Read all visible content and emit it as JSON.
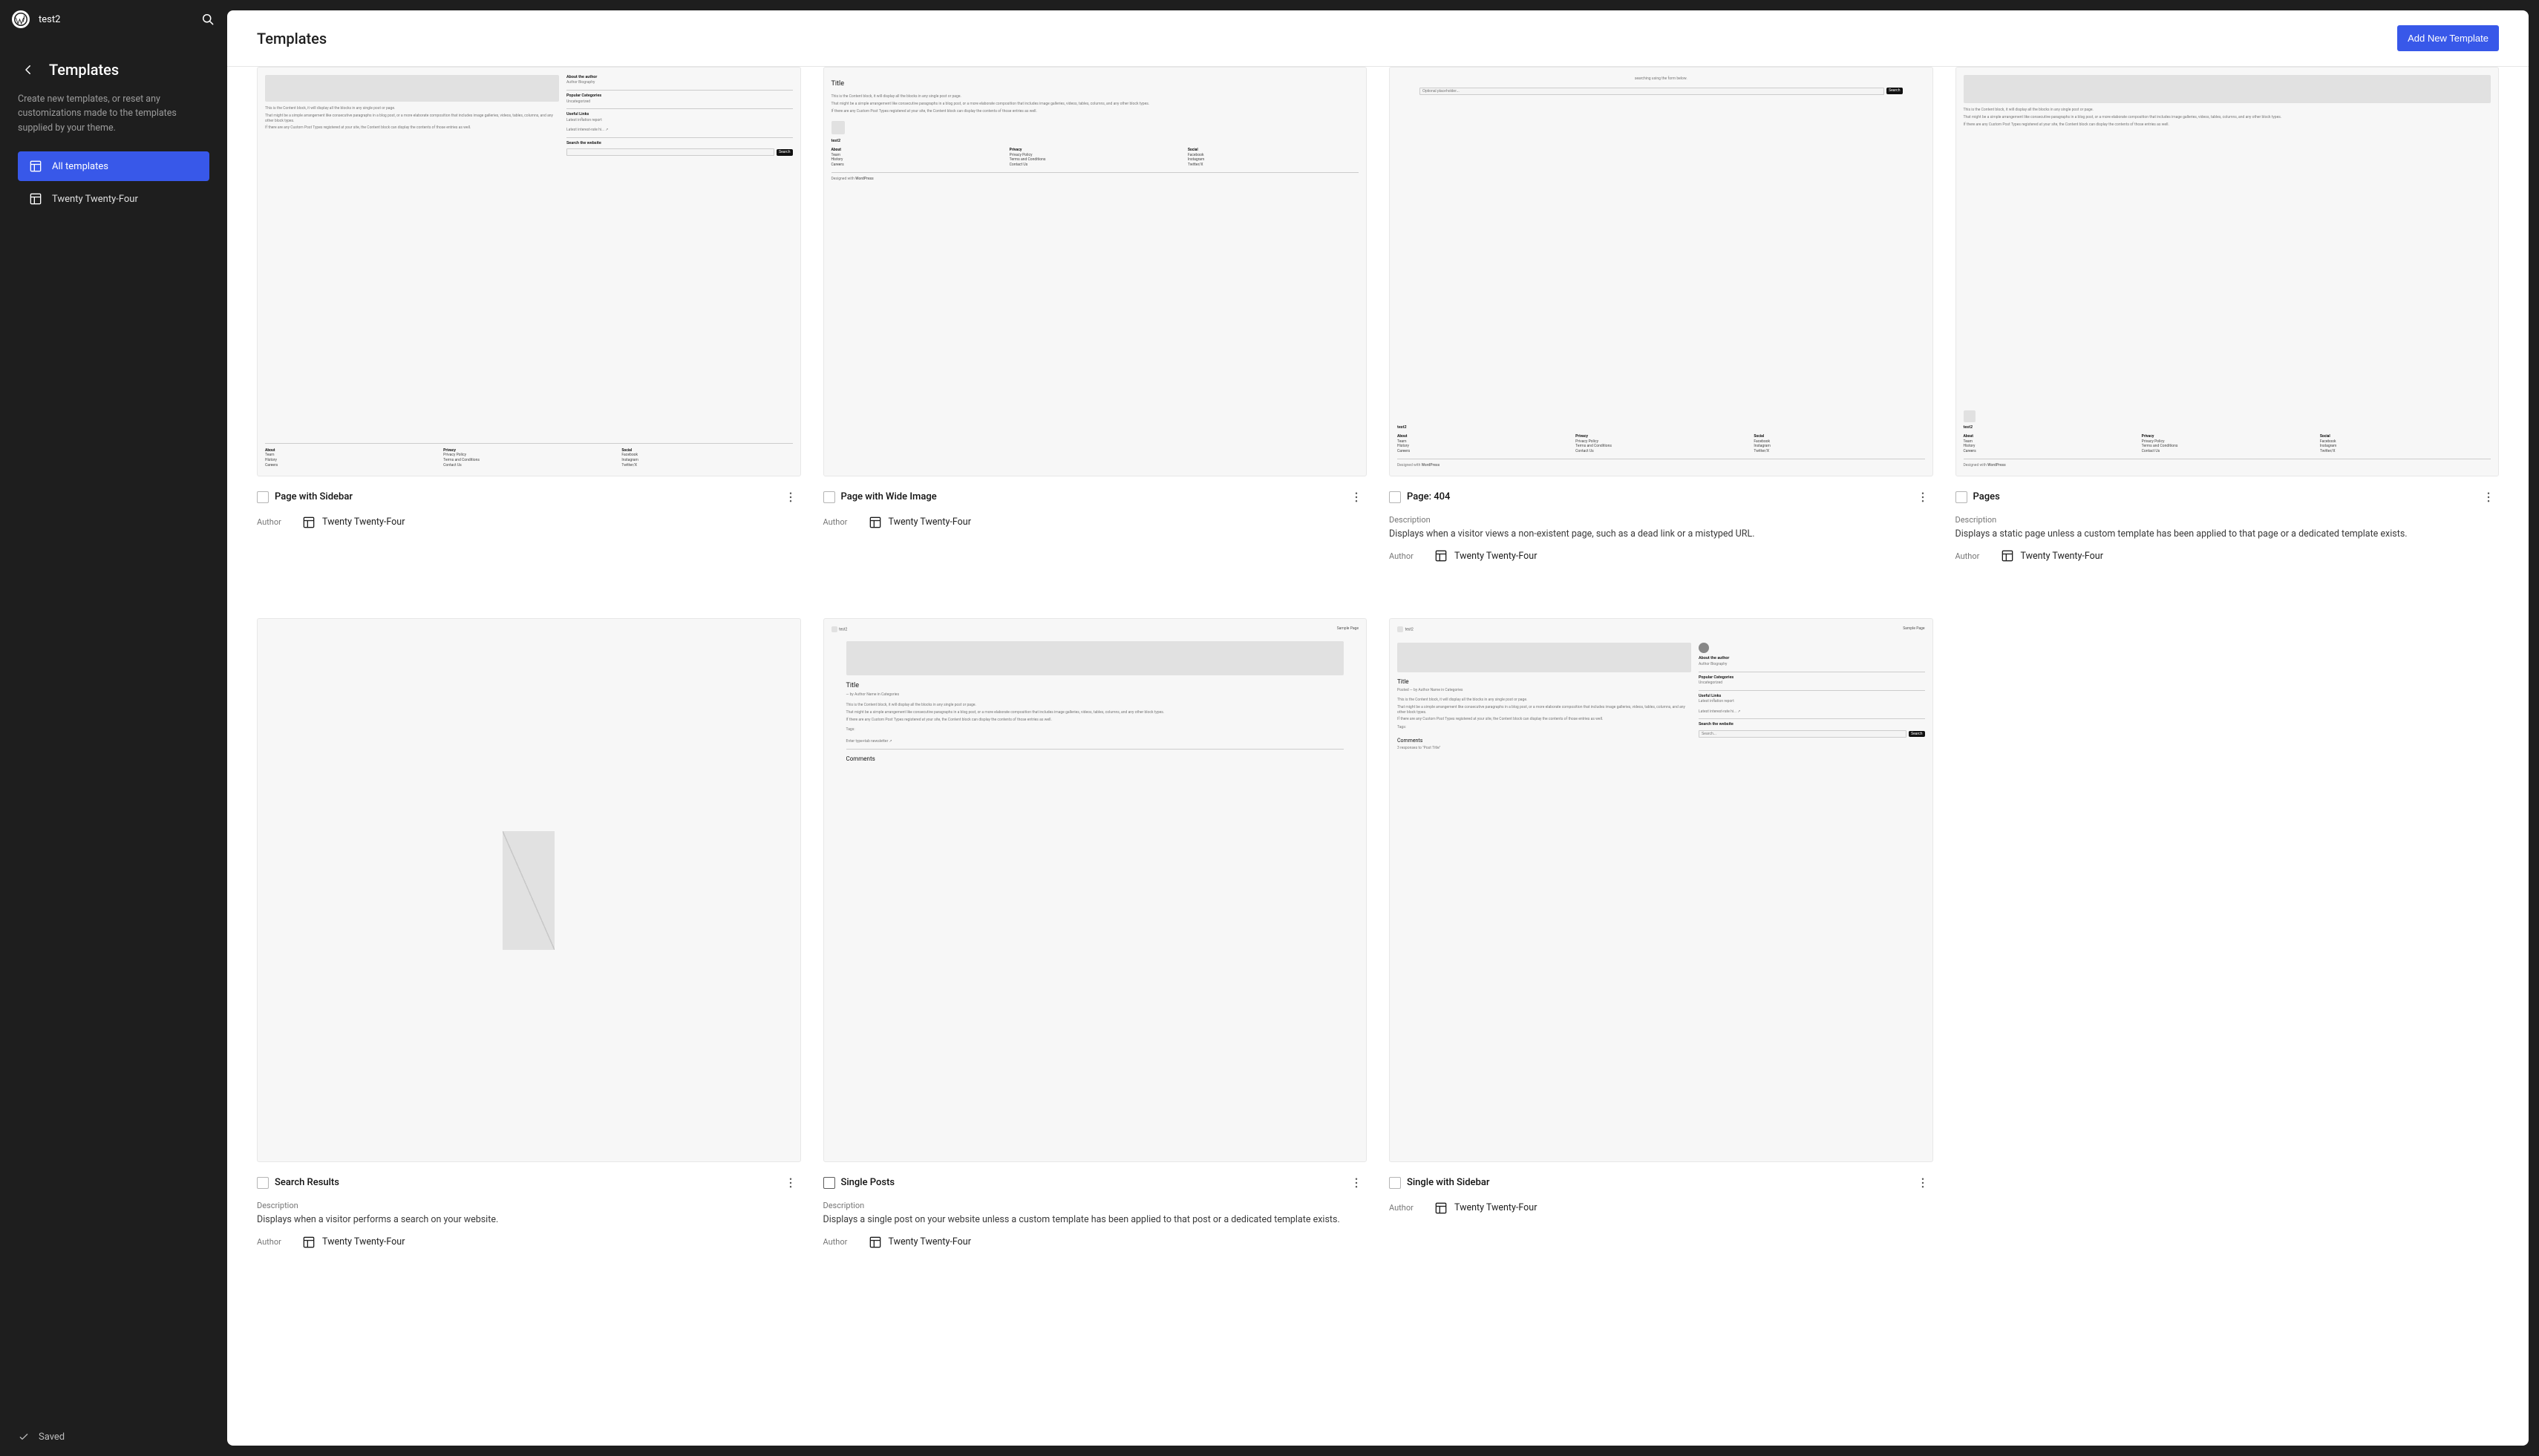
{
  "site": {
    "title": "test2"
  },
  "sidebar": {
    "back_aria": "Back",
    "title": "Templates",
    "description": "Create new templates, or reset any customizations made to the templates supplied by your theme.",
    "nav": [
      {
        "label": "All templates",
        "active": true
      },
      {
        "label": "Twenty Twenty-Four",
        "active": false
      }
    ]
  },
  "footer": {
    "saved_label": "Saved"
  },
  "main": {
    "title": "Templates",
    "add_button_label": "Add New Template"
  },
  "labels": {
    "description": "Description",
    "author": "Author"
  },
  "theme": {
    "name": "Twenty Twenty-Four"
  },
  "templates_row1": [
    {
      "id": "page-with-sidebar",
      "title": "Page with Sidebar",
      "preview": "sidebar-page",
      "has_description": false,
      "check_style": "dim",
      "author": "Twenty Twenty-Four"
    },
    {
      "id": "page-with-wide-image",
      "title": "Page with Wide Image",
      "preview": "wide-image",
      "has_description": false,
      "check_style": "dim",
      "author": "Twenty Twenty-Four"
    },
    {
      "id": "page-404",
      "title": "Page: 404",
      "preview": "404",
      "has_description": true,
      "description": "Displays when a visitor views a non-existent page, such as a dead link or a mistyped URL.",
      "check_style": "dim",
      "author": "Twenty Twenty-Four"
    },
    {
      "id": "pages",
      "title": "Pages",
      "preview": "pages",
      "has_description": true,
      "description": "Displays a static page unless a custom template has been applied to that page or a dedicated template exists.",
      "check_style": "dim",
      "author": "Twenty Twenty-Four"
    }
  ],
  "templates_row2": [
    {
      "id": "search-results",
      "title": "Search Results",
      "preview": "search",
      "has_description": true,
      "description": "Displays when a visitor performs a search on your website.",
      "check_style": "dim",
      "author": "Twenty Twenty-Four"
    },
    {
      "id": "single-posts",
      "title": "Single Posts",
      "preview": "single",
      "has_description": true,
      "description": "Displays a single post on your website unless a custom template has been applied to that post or a dedicated template exists.",
      "check_style": "outline",
      "author": "Twenty Twenty-Four"
    },
    {
      "id": "single-with-sidebar",
      "title": "Single with Sidebar",
      "preview": "single-sidebar",
      "has_description": false,
      "check_style": "dim",
      "author": "Twenty Twenty-Four"
    }
  ]
}
